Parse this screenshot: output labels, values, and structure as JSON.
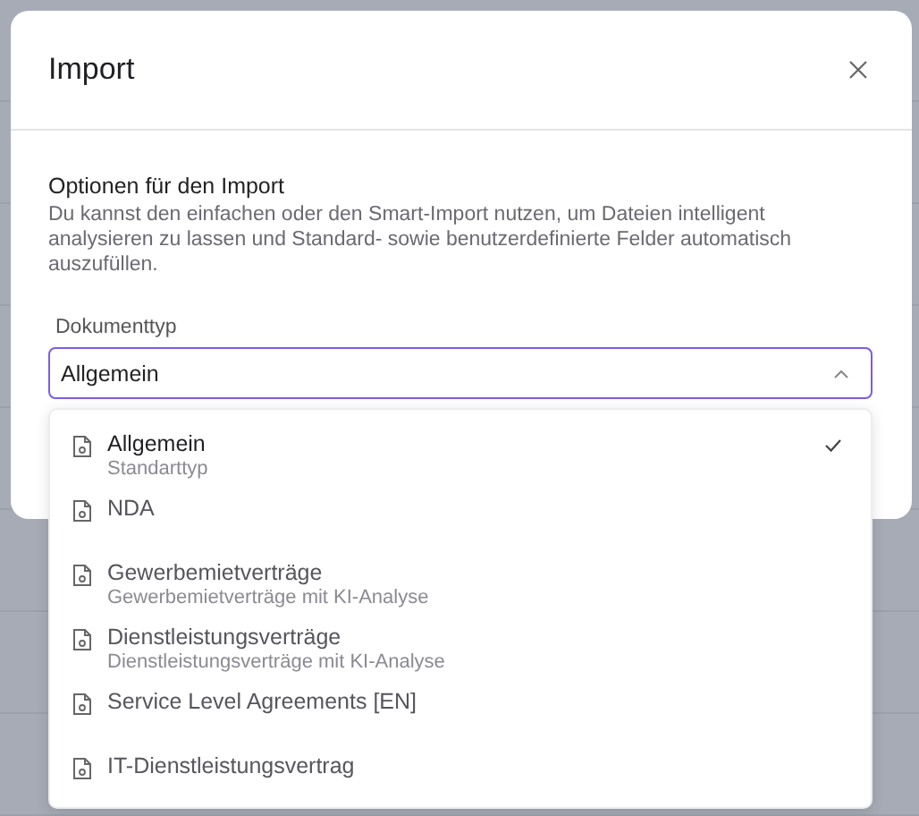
{
  "dialog": {
    "title": "Import",
    "section_title": "Optionen für den Import",
    "description": "Du kannst den einfachen oder den Smart-Import nutzen, um Dateien intelligent analysieren zu lassen und Standard- sowie benutzerdefinierte Felder automatisch auszufüllen.",
    "field_label": "Dokumenttyp",
    "select": {
      "value": "Allgemein",
      "expanded": true
    },
    "options": [
      {
        "label": "Allgemein",
        "subtitle": "Standarttyp",
        "selected": true
      },
      {
        "label": "NDA",
        "selected": false
      },
      {
        "label": "Gewerbemietverträge",
        "subtitle": "Gewerbemietverträge mit KI-Analyse",
        "selected": false
      },
      {
        "label": "Dienstleistungsverträge",
        "subtitle": "Dienstleistungsverträge mit KI-Analyse",
        "selected": false
      },
      {
        "label": "Service Level Agreements [EN]",
        "selected": false
      },
      {
        "label": "IT-Dienstleistungsvertrag",
        "selected": false
      }
    ]
  }
}
